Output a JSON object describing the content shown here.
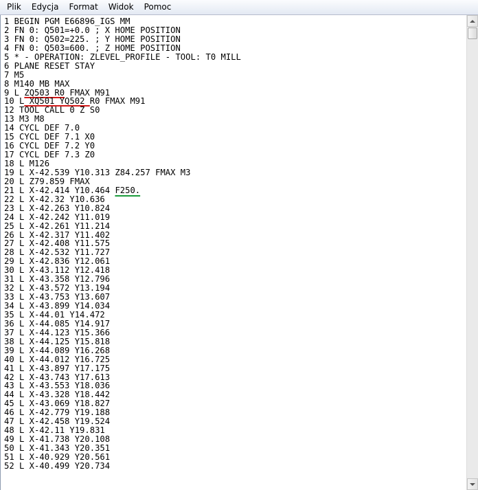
{
  "menu": {
    "items": [
      "Plik",
      "Edycja",
      "Format",
      "Widok",
      "Pomoc"
    ]
  },
  "editor": {
    "lines": [
      {
        "text": "1 BEGIN PGM E66896_IGS MM"
      },
      {
        "text": "2 FN 0: Q501=+0.0 ; X HOME POSITION"
      },
      {
        "text": "3 FN 0: Q502=225. ; Y HOME POSITION"
      },
      {
        "text": "4 FN 0: Q503=600. ; Z HOME POSITION"
      },
      {
        "text": "5 * - OPERATION: ZLEVEL_PROFILE - TOOL: T0 MILL"
      },
      {
        "text": "6 PLANE RESET STAY"
      },
      {
        "text": "7 M5"
      },
      {
        "text": "8 M140 MB MAX"
      },
      {
        "text": "9 L ZQ503 R0 FMAX M91",
        "underline": "red",
        "ul_start": 4,
        "ul_end": 12
      },
      {
        "text": "10 L XQ501 YQ502 R0 FMAX M91",
        "underline": "red",
        "ul_start": 4,
        "ul_end": 17
      },
      {
        "text": "12 TOOL CALL 0 Z S0"
      },
      {
        "text": "13 M3 M8"
      },
      {
        "text": "14 CYCL DEF 7.0"
      },
      {
        "text": "15 CYCL DEF 7.1 X0"
      },
      {
        "text": "16 CYCL DEF 7.2 Y0"
      },
      {
        "text": "17 CYCL DEF 7.3 Z0"
      },
      {
        "text": "18 L M126"
      },
      {
        "text": "19 L X-42.539 Y10.313 Z84.257 FMAX M3"
      },
      {
        "text": "20 L Z79.859 FMAX"
      },
      {
        "text": "21 L X-42.414 Y10.464 F250.",
        "underline": "green",
        "ul_start": 22,
        "ul_end": 27
      },
      {
        "text": "22 L X-42.32 Y10.636"
      },
      {
        "text": "23 L X-42.263 Y10.824"
      },
      {
        "text": "24 L X-42.242 Y11.019"
      },
      {
        "text": "25 L X-42.261 Y11.214"
      },
      {
        "text": "26 L X-42.317 Y11.402"
      },
      {
        "text": "27 L X-42.408 Y11.575"
      },
      {
        "text": "28 L X-42.532 Y11.727"
      },
      {
        "text": "29 L X-42.836 Y12.061"
      },
      {
        "text": "30 L X-43.112 Y12.418"
      },
      {
        "text": "31 L X-43.358 Y12.796"
      },
      {
        "text": "32 L X-43.572 Y13.194"
      },
      {
        "text": "33 L X-43.753 Y13.607"
      },
      {
        "text": "34 L X-43.899 Y14.034"
      },
      {
        "text": "35 L X-44.01 Y14.472"
      },
      {
        "text": "36 L X-44.085 Y14.917"
      },
      {
        "text": "37 L X-44.123 Y15.366"
      },
      {
        "text": "38 L X-44.125 Y15.818"
      },
      {
        "text": "39 L X-44.089 Y16.268"
      },
      {
        "text": "40 L X-44.012 Y16.725"
      },
      {
        "text": "41 L X-43.897 Y17.175"
      },
      {
        "text": "42 L X-43.743 Y17.613"
      },
      {
        "text": "43 L X-43.553 Y18.036"
      },
      {
        "text": "44 L X-43.328 Y18.442"
      },
      {
        "text": "45 L X-43.069 Y18.827"
      },
      {
        "text": "46 L X-42.779 Y19.188"
      },
      {
        "text": "47 L X-42.458 Y19.524"
      },
      {
        "text": "48 L X-42.11 Y19.831"
      },
      {
        "text": "49 L X-41.738 Y20.108"
      },
      {
        "text": "50 L X-41.343 Y20.351"
      },
      {
        "text": "51 L X-40.929 Y20.561"
      },
      {
        "text": "52 L X-40.499 Y20.734"
      }
    ]
  },
  "colors": {
    "annotation_red": "#d11818",
    "annotation_green": "#1a9a3a"
  },
  "icons": {
    "scroll_up": "arrow-up-icon",
    "scroll_down": "arrow-down-icon"
  }
}
